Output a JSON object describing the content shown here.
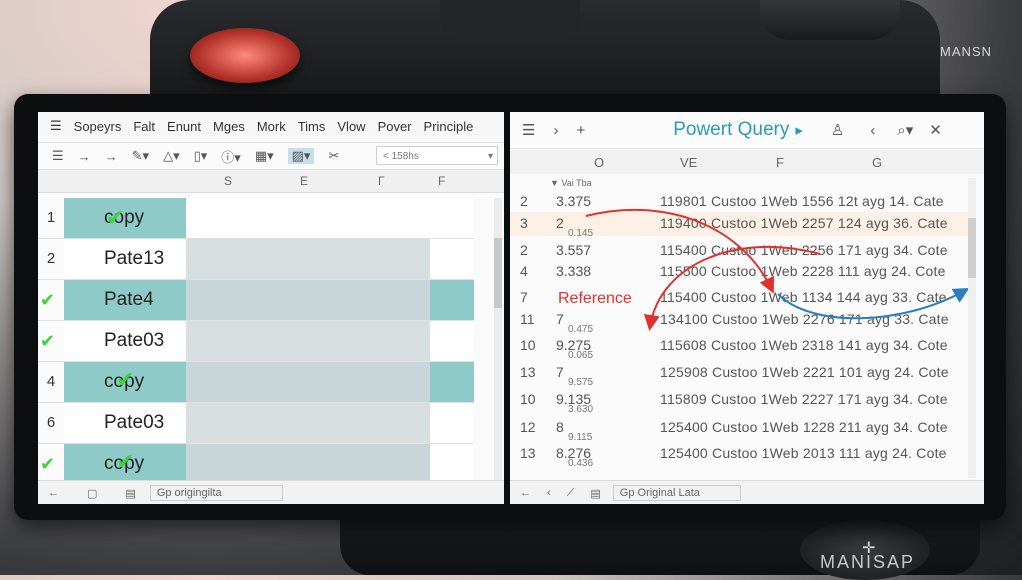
{
  "camera": {
    "brand_top": "MANSN",
    "brand_bottom": "MANISAP"
  },
  "left": {
    "menu": [
      "Sopeyrs",
      "Falt",
      "Enunt",
      "Mges",
      "Mork",
      "Tims",
      "Vlow",
      "Pover",
      "Principle"
    ],
    "toolbar_icons": [
      "menu-icon",
      "arrow-right-icon",
      "arrow-right-icon",
      "pen-icon",
      "warning-icon",
      "phone-icon",
      "info-icon",
      "grid-icon",
      "image-icon",
      "scissors-icon"
    ],
    "formula_value": "< 158hs",
    "columns": [
      "S",
      "E",
      "Γ",
      "F"
    ],
    "rows": [
      {
        "num": "1",
        "label": "copy",
        "check": true,
        "fill": "teal"
      },
      {
        "num": "2",
        "label": "Pate13",
        "check": false,
        "fill": "white"
      },
      {
        "num": "",
        "label": "Pate4",
        "check": true,
        "fill": "teal"
      },
      {
        "num": "",
        "label": "Pate03",
        "check": true,
        "fill": "white"
      },
      {
        "num": "4",
        "label": "copy",
        "check": true,
        "fill": "teal"
      },
      {
        "num": "6",
        "label": "Pate03",
        "check": false,
        "fill": "white"
      },
      {
        "num": "",
        "label": "copy",
        "check": true,
        "fill": "teal"
      }
    ],
    "status_text": "Gp origingilta"
  },
  "right": {
    "title": "Powert Query",
    "columns": [
      "O",
      "VE",
      "F",
      "G"
    ],
    "subheader": "▼ Vai Tba",
    "reference_label": "Reference",
    "rows": [
      {
        "num": "2",
        "val": "3.375",
        "small": "",
        "data": "119801 Custoo 1Web 1556 12t ayg 14. Cate"
      },
      {
        "num": "3",
        "val": "2",
        "small": "0.145",
        "data": "119400 Custoo 1Web 2257 124 ayg 36. Cate"
      },
      {
        "num": "2",
        "val": "3.557",
        "small": "",
        "data": "115400 Custoo 1Web 2256 171 ayg 34. Cote"
      },
      {
        "num": "4",
        "val": "3.338",
        "small": "",
        "data": "115500 Custoo 1Web 2228 111 ayg 24. Cote"
      },
      {
        "num": "7",
        "val": "",
        "small": "",
        "data": "115400 Custoo 1Web 1134 144 ayg 33. Cate"
      },
      {
        "num": "11",
        "val": "7",
        "small": "0.475",
        "data": "134100 Custoo 1Web 2276 171 ayg 33. Cate"
      },
      {
        "num": "10",
        "val": "9.275",
        "small": "0.065",
        "data": "115608 Custoo 1Web 2318 141 ayg 34. Cote"
      },
      {
        "num": "13",
        "val": "7",
        "small": "9.575",
        "data": "125908 Custoo 1Web 2221 101 ayg 24. Cote"
      },
      {
        "num": "10",
        "val": "9.135",
        "small": "3.630",
        "data": "115809 Custoo 1Web 2227 171 ayg 34. Cote"
      },
      {
        "num": "12",
        "val": "8",
        "small": "9.115",
        "data": "125400 Custoo 1Web 1228 211 ayg 34. Cote"
      },
      {
        "num": "13",
        "val": "8.276",
        "small": "0.436",
        "data": "125400 Custoo 1Web 2013 111 ayg 24. Cote"
      }
    ],
    "status_text": "Gp Original Lata"
  },
  "colors": {
    "teal": "#8ecac7",
    "accent": "#2b9bb8",
    "arrow_red": "#e0322c",
    "arrow_blue": "#2a7fc0",
    "check": "#3ed43a"
  }
}
